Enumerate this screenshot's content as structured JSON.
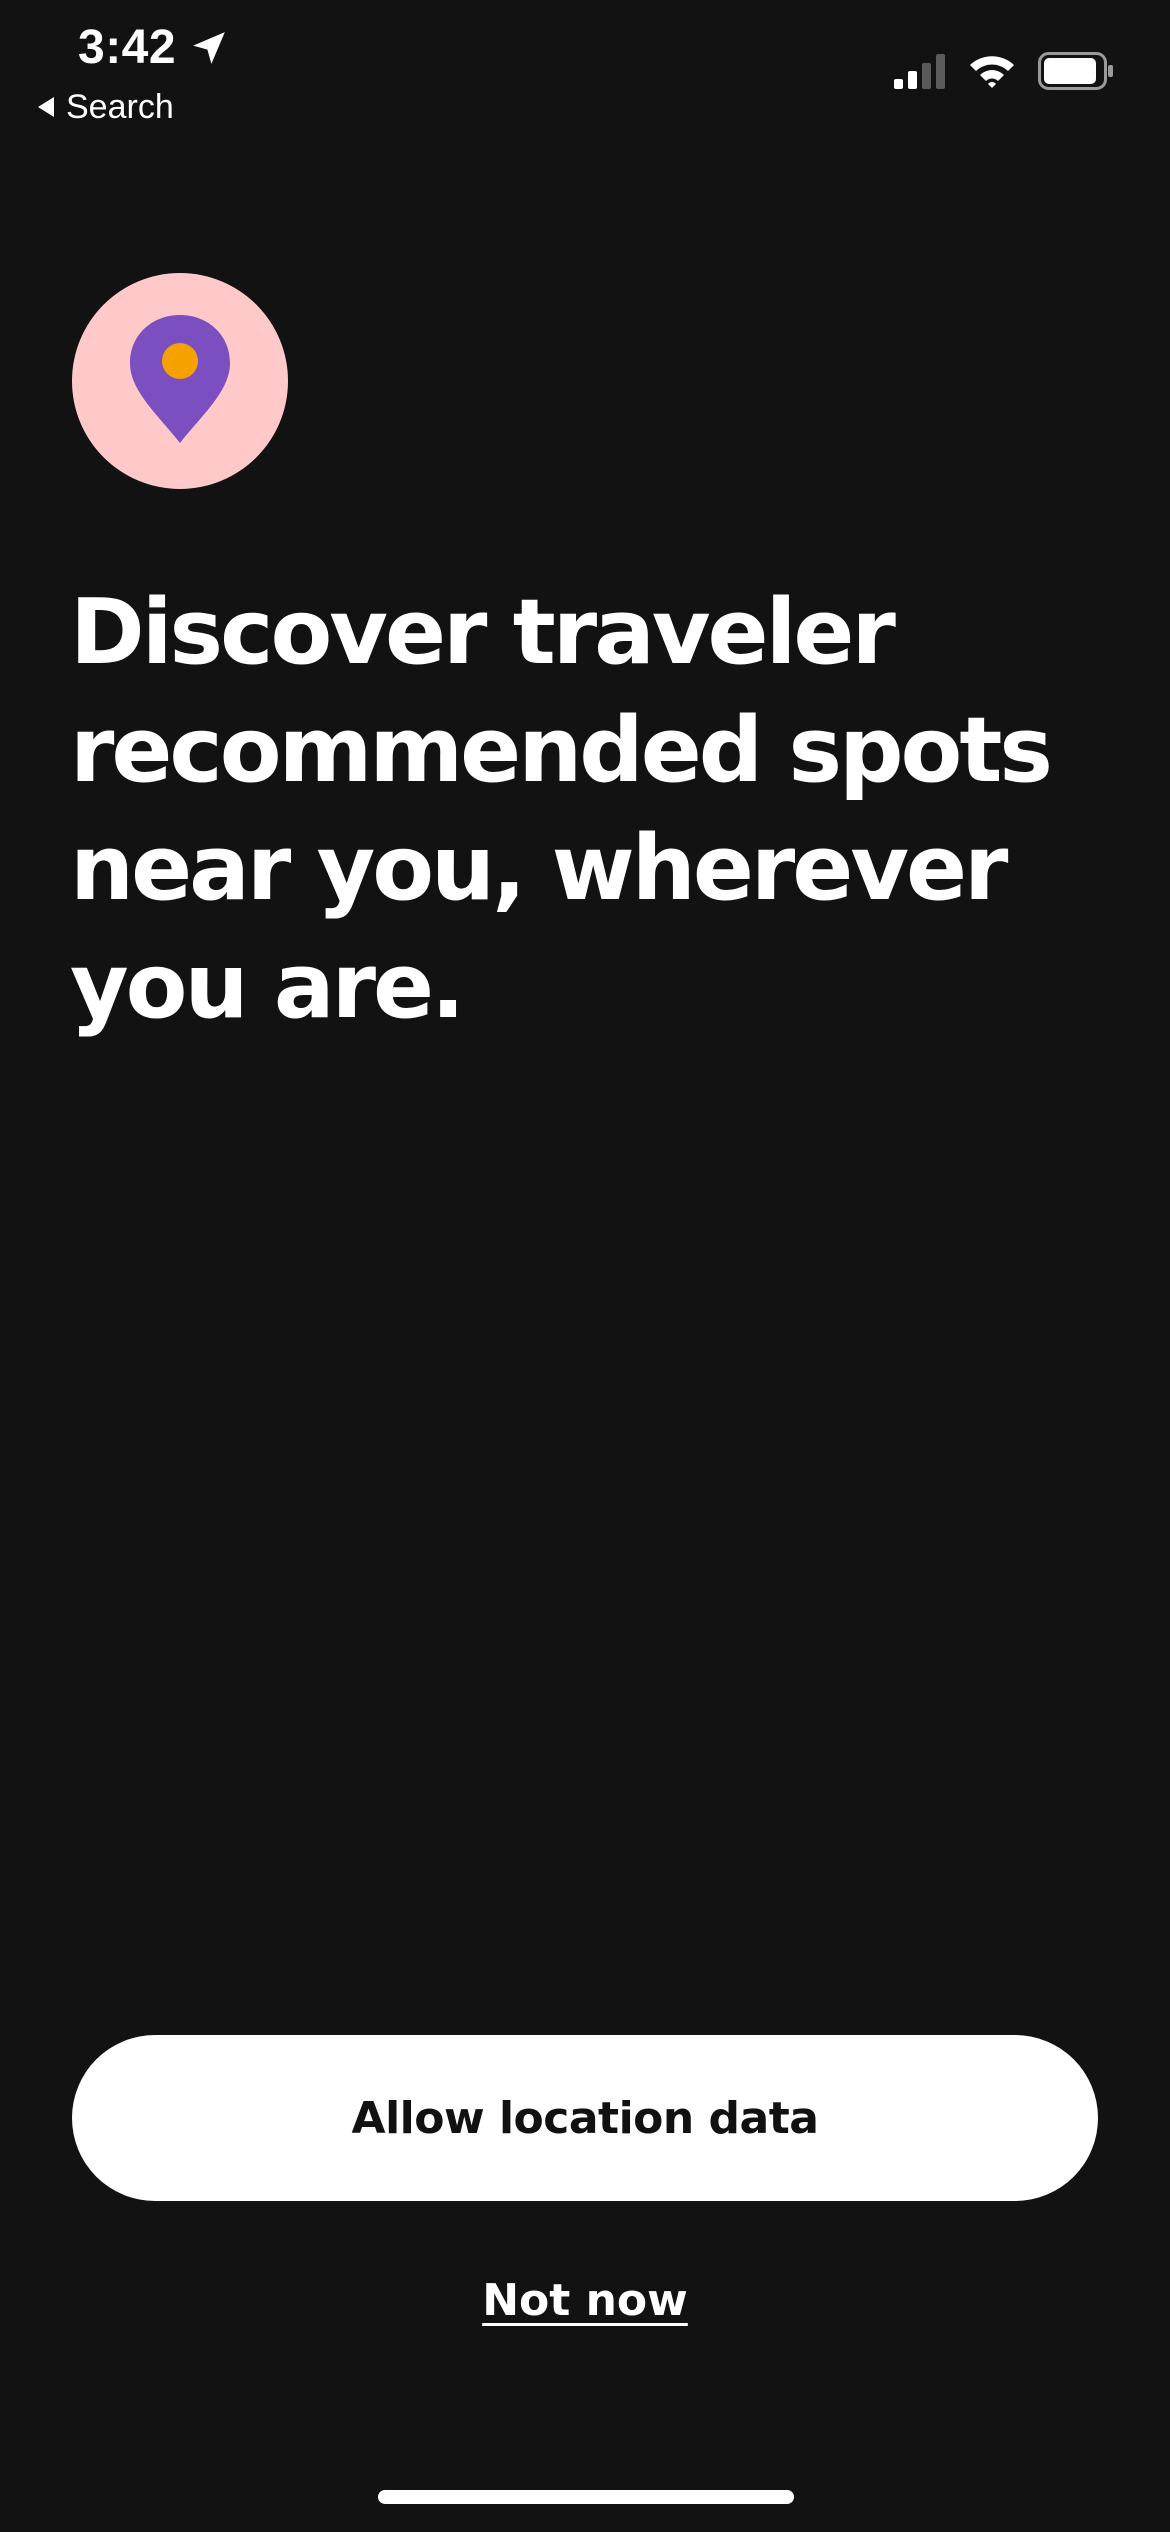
{
  "status_bar": {
    "time": "3:42",
    "back_label": "Search",
    "icons": [
      "location-arrow-icon",
      "signal-icon",
      "wifi-icon",
      "battery-icon"
    ]
  },
  "prompt": {
    "icon": "location-pin-icon",
    "headline": "Discover traveler recommended spots near you, wherever you are."
  },
  "actions": {
    "allow_label": "Allow location data",
    "dismiss_label": "Not now"
  },
  "colors": {
    "background": "#121212",
    "pin_circle": "#ffc9c9",
    "pin": "#7b4fbf",
    "pin_dot": "#f5a100",
    "button_bg": "#ffffff"
  }
}
